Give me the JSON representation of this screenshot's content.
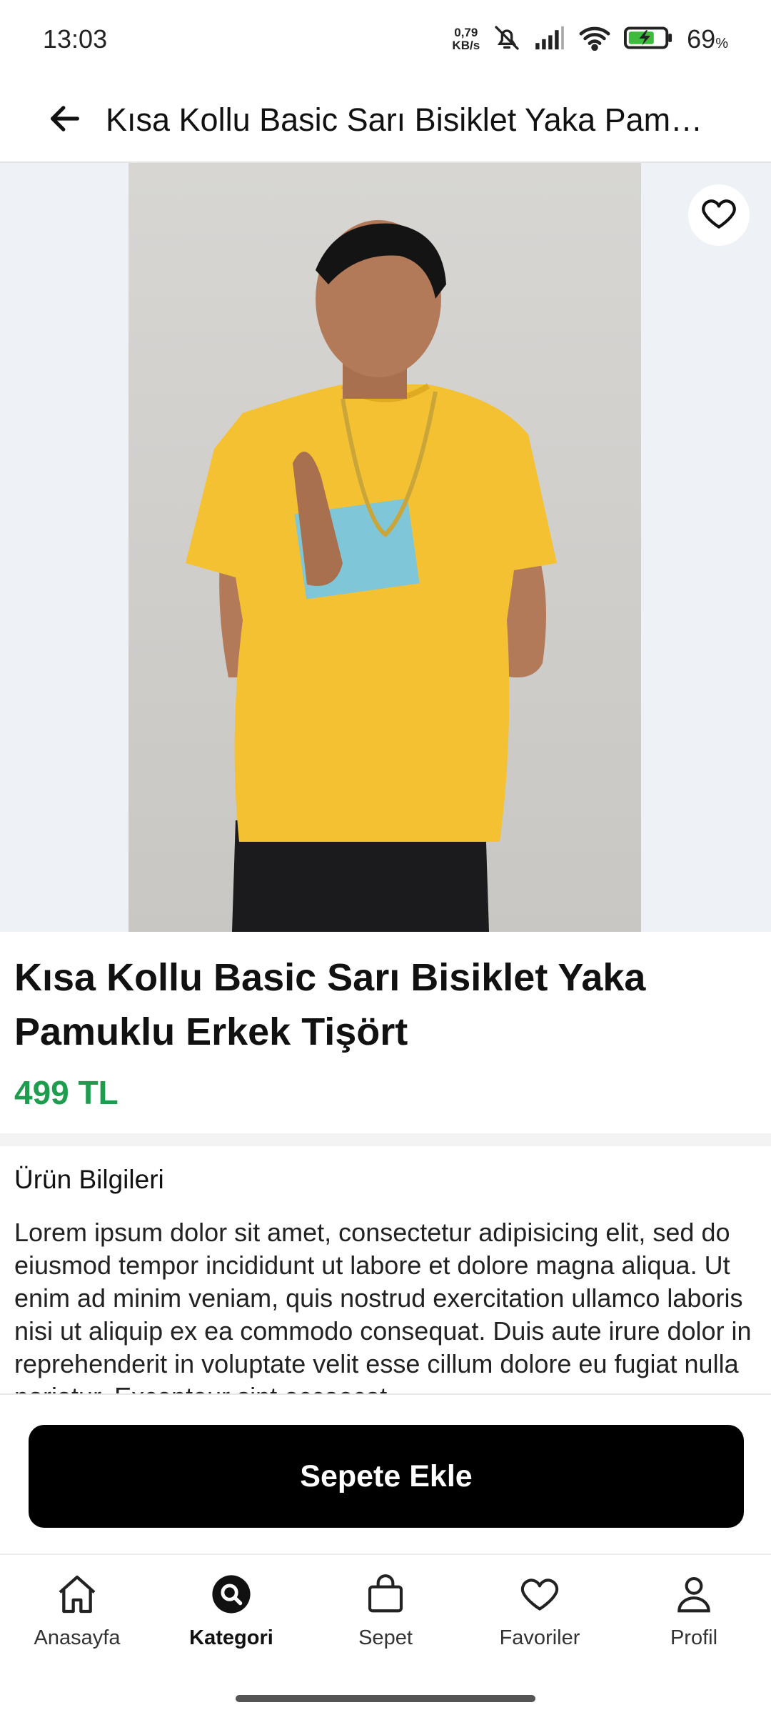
{
  "status_bar": {
    "time": "13:03",
    "net_speed_value": "0,79",
    "net_speed_unit": "KB/s",
    "battery_percent": "69",
    "battery_unit": "%",
    "icons": [
      "mute-icon",
      "signal-icon",
      "wifi-icon",
      "battery-charging-icon"
    ]
  },
  "app_bar": {
    "back_icon": "arrow-left-icon",
    "title": "Kısa Kollu Basic Sarı Bisiklet Yaka Pamuklu Erkek Tişört"
  },
  "gallery": {
    "favorite_icon": "heart-outline-icon"
  },
  "product": {
    "name": "Kısa Kollu Basic Sarı Bisiklet Yaka Pamuklu Erkek Tişört",
    "price": "499 TL",
    "price_color": "#1f9d4f"
  },
  "description": {
    "title": "Ürün Bilgileri",
    "body": "Lorem ipsum dolor sit amet, consectetur adipisicing elit, sed do eiusmod tempor incididunt ut labore et dolore magna aliqua. Ut enim ad minim veniam, quis nostrud exercitation ullamco laboris nisi ut aliquip ex ea commodo consequat. Duis aute irure dolor in reprehenderit in voluptate velit esse cillum dolore eu fugiat nulla pariatur. Excepteur sint occaecat"
  },
  "cart": {
    "button_label": "Sepete Ekle"
  },
  "bottom_nav": {
    "items": [
      {
        "label": "Anasayfa",
        "icon": "home-icon",
        "active": false
      },
      {
        "label": "Kategori",
        "icon": "search-circle-icon",
        "active": true
      },
      {
        "label": "Sepet",
        "icon": "shopping-bag-icon",
        "active": false
      },
      {
        "label": "Favoriler",
        "icon": "heart-icon",
        "active": false
      },
      {
        "label": "Profil",
        "icon": "user-icon",
        "active": false
      }
    ]
  }
}
